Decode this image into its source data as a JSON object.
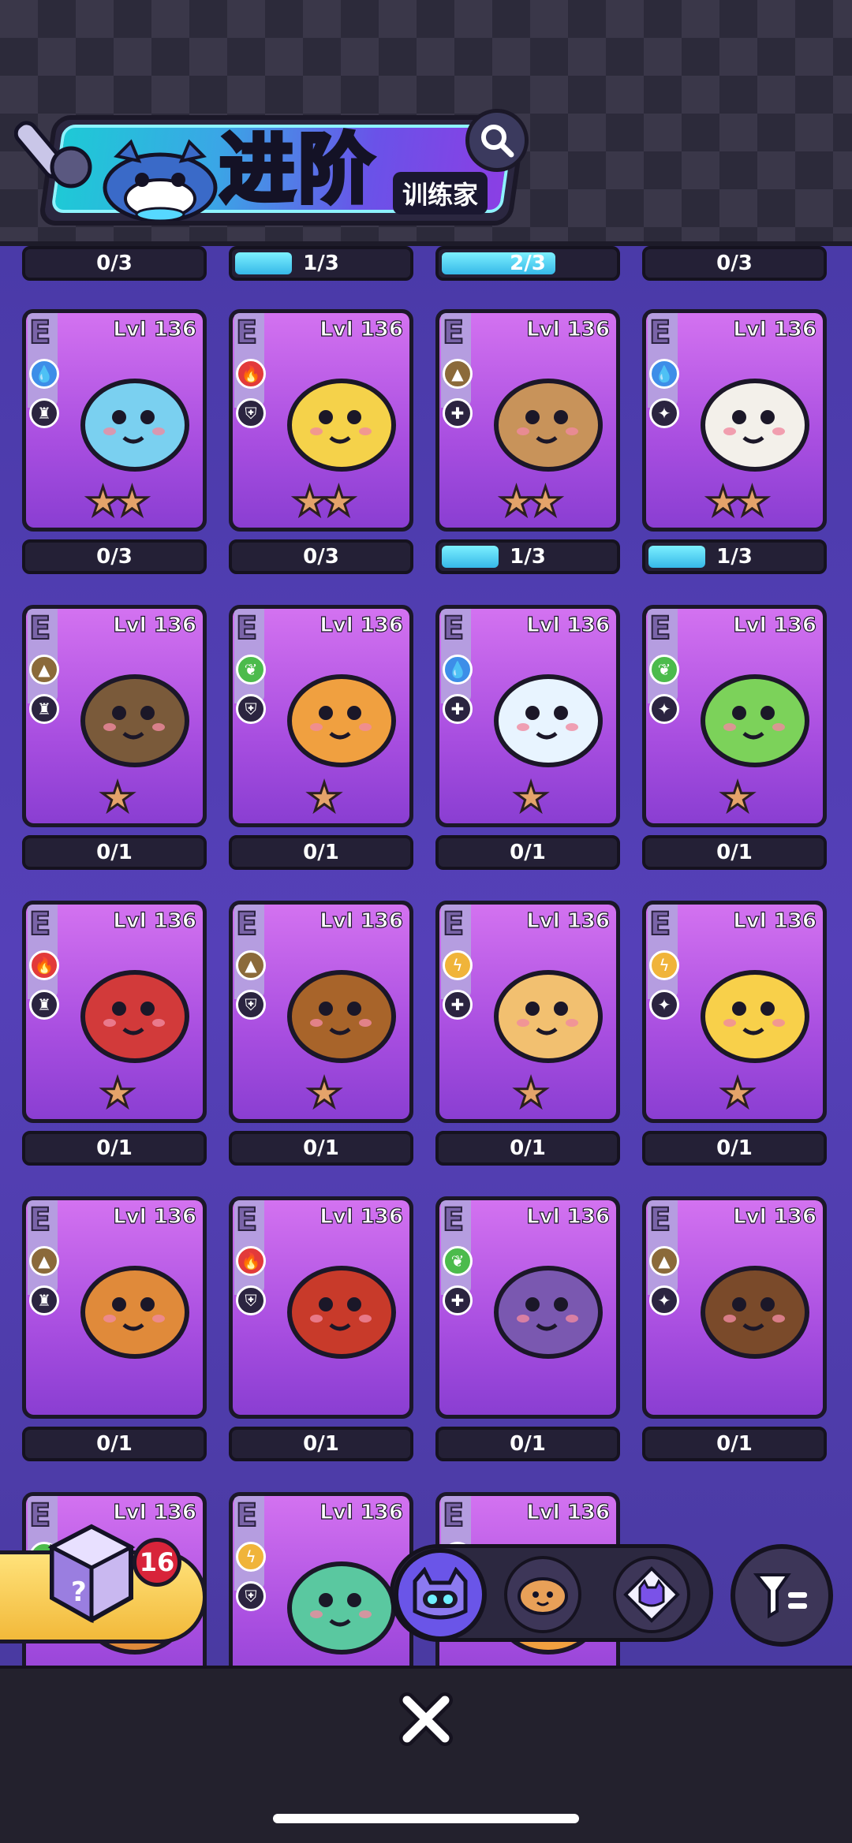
{
  "header": {
    "title": "进阶",
    "subtitle": "训练家"
  },
  "top_progress": [
    {
      "label": "0/3",
      "fill": 0.0
    },
    {
      "label": "1/3",
      "fill": 0.33
    },
    {
      "label": "2/3",
      "fill": 0.66
    },
    {
      "label": "0/3",
      "fill": 0.0
    }
  ],
  "cards": [
    {
      "rank": "E",
      "level": "Lvl 136",
      "element": "water",
      "stars": "★★",
      "progress": "0/3",
      "fill": 0.0,
      "color": "#7ad0f0"
    },
    {
      "rank": "E",
      "level": "Lvl 136",
      "element": "fire",
      "stars": "★★",
      "progress": "0/3",
      "fill": 0.0,
      "color": "#f5d24a"
    },
    {
      "rank": "E",
      "level": "Lvl 136",
      "element": "earth",
      "stars": "★★",
      "progress": "1/3",
      "fill": 0.33,
      "color": "#c8935a"
    },
    {
      "rank": "E",
      "level": "Lvl 136",
      "element": "water",
      "stars": "★★",
      "progress": "1/3",
      "fill": 0.33,
      "color": "#f3f0ea"
    },
    {
      "rank": "E",
      "level": "Lvl 136",
      "element": "earth",
      "stars": "★",
      "progress": "0/1",
      "fill": 0.0,
      "color": "#7a5a3a"
    },
    {
      "rank": "E",
      "level": "Lvl 136",
      "element": "leaf",
      "stars": "★",
      "progress": "0/1",
      "fill": 0.0,
      "color": "#f0a040"
    },
    {
      "rank": "E",
      "level": "Lvl 136",
      "element": "water",
      "stars": "★",
      "progress": "0/1",
      "fill": 0.0,
      "color": "#e8f4ff"
    },
    {
      "rank": "E",
      "level": "Lvl 136",
      "element": "leaf",
      "stars": "★",
      "progress": "0/1",
      "fill": 0.0,
      "color": "#7cd25a"
    },
    {
      "rank": "E",
      "level": "Lvl 136",
      "element": "fire",
      "stars": "★",
      "progress": "0/1",
      "fill": 0.0,
      "color": "#d23a3a"
    },
    {
      "rank": "E",
      "level": "Lvl 136",
      "element": "earth",
      "stars": "★",
      "progress": "0/1",
      "fill": 0.0,
      "color": "#a8642a"
    },
    {
      "rank": "E",
      "level": "Lvl 136",
      "element": "bolt",
      "stars": "★",
      "progress": "0/1",
      "fill": 0.0,
      "color": "#f2c070"
    },
    {
      "rank": "E",
      "level": "Lvl 136",
      "element": "bolt",
      "stars": "★",
      "progress": "0/1",
      "fill": 0.0,
      "color": "#f8d04a"
    },
    {
      "rank": "E",
      "level": "Lvl 136",
      "element": "earth",
      "stars": "",
      "progress": "0/1",
      "fill": 0.0,
      "color": "#e08a3a"
    },
    {
      "rank": "E",
      "level": "Lvl 136",
      "element": "fire",
      "stars": "",
      "progress": "0/1",
      "fill": 0.0,
      "color": "#c83a2a"
    },
    {
      "rank": "E",
      "level": "Lvl 136",
      "element": "leaf",
      "stars": "",
      "progress": "0/1",
      "fill": 0.0,
      "color": "#7a58b0"
    },
    {
      "rank": "E",
      "level": "Lvl 136",
      "element": "earth",
      "stars": "",
      "progress": "0/1",
      "fill": 0.0,
      "color": "#7a4a2a"
    },
    {
      "rank": "E",
      "level": "Lvl 136",
      "element": "leaf",
      "stars": "",
      "progress": "",
      "fill": 0.0,
      "color": "#e08a3a"
    },
    {
      "rank": "E",
      "level": "Lvl 136",
      "element": "bolt",
      "stars": "",
      "progress": "",
      "fill": 0.0,
      "color": "#5ac8a0"
    },
    {
      "rank": "E",
      "level": "Lvl 136",
      "element": "water",
      "stars": "",
      "progress": "",
      "fill": 0.0,
      "color": "#f0a040"
    }
  ],
  "egg_count": "16",
  "tabs": [
    "creature-tab",
    "food-tab",
    "crystal-tab"
  ],
  "icons": {
    "search": "magnifier-icon",
    "close": "close-icon",
    "filter": "filter-icon"
  }
}
